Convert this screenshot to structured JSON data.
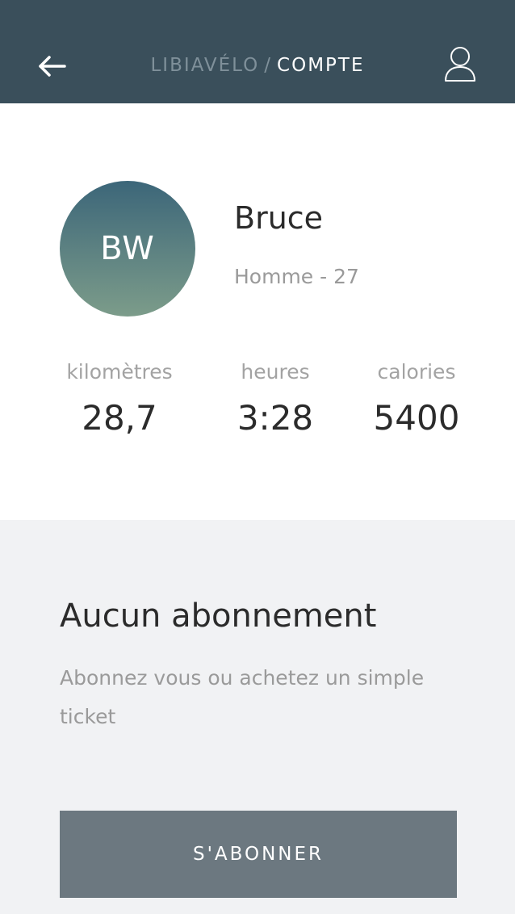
{
  "header": {
    "back_icon": "arrow-left-icon",
    "breadcrumb_root": "LIBIAVÉLO",
    "breadcrumb_separator": "/",
    "breadcrumb_current": "COMPTE",
    "user_icon": "user-icon"
  },
  "profile": {
    "initials": "BW",
    "name": "Bruce",
    "subtitle": "Homme - 27",
    "stats": [
      {
        "label": "kilomètres",
        "value": "28,7"
      },
      {
        "label": "heures",
        "value": "3:28"
      },
      {
        "label": "calories",
        "value": "5400"
      }
    ]
  },
  "subscription": {
    "title": "Aucun abonnement",
    "description": "Abonnez vous ou achetez un simple ticket",
    "button_label": "S'ABONNER"
  },
  "colors": {
    "header_bg": "#3a4f5b",
    "avatar_gradient_top": "#3c6679",
    "avatar_gradient_bottom": "#7c9c8a",
    "button_bg": "#6c7880",
    "section_bg": "#f1f2f4"
  }
}
